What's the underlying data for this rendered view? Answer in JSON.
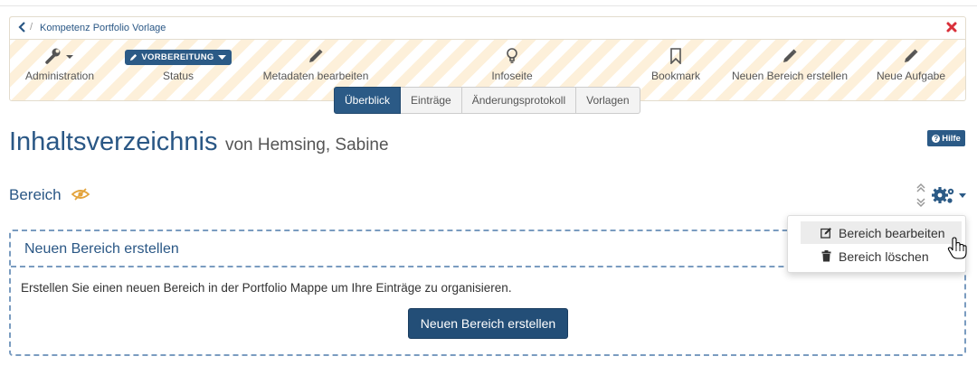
{
  "breadcrumb": {
    "back_icon": "chevron-left-icon",
    "separator": "/",
    "link": "Kompetenz Portfolio Vorlage",
    "close_icon": "close-icon"
  },
  "toolbar": {
    "administration": "Administration",
    "status_badge": "VORBEREITUNG",
    "status": "Status",
    "metadata": "Metadaten bearbeiten",
    "infopage": "Infoseite",
    "bookmark": "Bookmark",
    "new_section": "Neuen Bereich erstellen",
    "new_task": "Neue Aufgabe"
  },
  "tabs": [
    "Überblick",
    "Einträge",
    "Änderungsprotokoll",
    "Vorlagen"
  ],
  "active_tab": "Überblick",
  "page": {
    "title": "Inhaltsverzeichnis",
    "subtitle": "von Hemsing, Sabine",
    "help": "Hilfe"
  },
  "section": {
    "title": "Bereich"
  },
  "menu": {
    "edit": "Bereich bearbeiten",
    "delete": "Bereich löschen"
  },
  "newbox": {
    "title": "Neuen Bereich erstellen",
    "text": "Erstellen Sie einen neuen Bereich in der Portfolio Mappe um Ihre Einträge zu organisieren.",
    "button": "Neuen Bereich erstellen"
  },
  "colors": {
    "primary": "#2b5a86",
    "link": "#2a5785",
    "close": "#d9303a",
    "stripe": "#fdf0da",
    "eye": "#e3a33b"
  }
}
